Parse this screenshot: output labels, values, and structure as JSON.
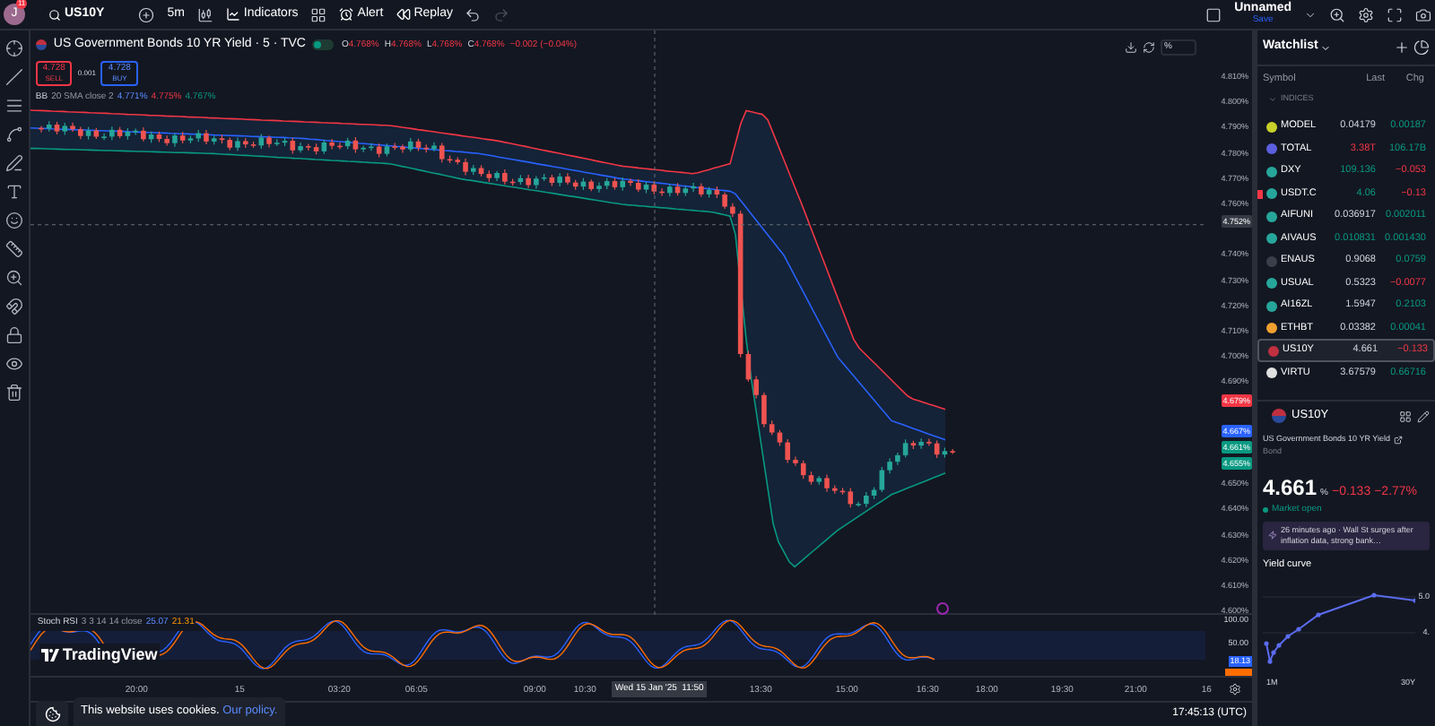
{
  "top_bar": {
    "avatar": "J",
    "notifications": "11",
    "symbol": "US10Y",
    "interval": "5m",
    "indicators": "Indicators",
    "alert": "Alert",
    "replay": "Replay",
    "layout_name": "Unnamed",
    "save": "Save"
  },
  "chart": {
    "title": "US Government Bonds 10 YR Yield · 5 · TVC",
    "market_open": true,
    "ohlc": [
      {
        "key": "O",
        "value": "4.768%"
      },
      {
        "key": "H",
        "value": "4.768%"
      },
      {
        "key": "L",
        "value": "4.768%"
      },
      {
        "key": "C",
        "value": "4.768%"
      }
    ],
    "change": "−0.002 (−0.04%)",
    "sell": {
      "price": "4.728",
      "label": "SELL"
    },
    "spread": "0.001",
    "buy": {
      "price": "4.728",
      "label": "BUY"
    },
    "indicator": {
      "name": "BB",
      "params": "20 SMA close 2",
      "values": [
        "4.771%",
        "4.775%",
        "4.767%"
      ]
    },
    "scale_mode": "%",
    "price_ticks": [
      "4.810%",
      "4.800%",
      "4.790%",
      "4.780%",
      "4.770%",
      "4.760%",
      "4.740%",
      "4.730%",
      "4.720%",
      "4.710%",
      "4.700%",
      "4.690%",
      "4.650%",
      "4.640%",
      "4.630%",
      "4.620%",
      "4.610%",
      "4.600%"
    ],
    "price_markers": [
      {
        "label": "4.752%",
        "kind": "crosshair"
      },
      {
        "label": "4.679%",
        "kind": "upper"
      },
      {
        "label": "4.667%",
        "kind": "middle"
      },
      {
        "label": "4.661%",
        "kind": "price"
      },
      {
        "label": "4.655%",
        "kind": "lower"
      }
    ],
    "logo": "TradingView",
    "stoch": {
      "name": "Stoch RSI",
      "params": "3 3 14 14 close",
      "values": [
        "25.07",
        "21.31"
      ],
      "ticks": [
        "100.00",
        "50.00"
      ],
      "marker": "18.13"
    },
    "time_ticks": [
      "20:00",
      "15",
      "03:20",
      "06:05",
      "09:00",
      "10:30",
      "13:30",
      "15:00",
      "16:30",
      "18:00",
      "19:30",
      "21:00",
      "16"
    ],
    "crosshair_time": "Wed 15 Jan '25",
    "crosshair_clock": "11:50",
    "clock": "17:45:13 (UTC)"
  },
  "watchlist": {
    "title": "Watchlist",
    "columns": [
      "Symbol",
      "Last",
      "Chg"
    ],
    "section": "INDICES",
    "rows": [
      {
        "symbol": "MODEL",
        "last": "0.04179",
        "chg": "0.00187",
        "last_rising": false,
        "last_falling": false,
        "rising": true,
        "color": "#c8d02a",
        "flagged": false,
        "selected": false
      },
      {
        "symbol": "TOTAL",
        "last": "3.38T",
        "chg": "106.17B",
        "last_rising": false,
        "last_falling": true,
        "rising": true,
        "color": "#5b5fe0",
        "flagged": false,
        "selected": false
      },
      {
        "symbol": "DXY",
        "last": "109.136",
        "chg": "−0.053",
        "last_rising": true,
        "last_falling": false,
        "rising": false,
        "color": "#26a69a",
        "flagged": false,
        "selected": false
      },
      {
        "symbol": "USDT.C",
        "last": "4.06",
        "chg": "−0.13",
        "last_rising": true,
        "last_falling": false,
        "rising": false,
        "color": "#26a69a",
        "flagged": true,
        "selected": false
      },
      {
        "symbol": "AIFUNI",
        "last": "0.036917",
        "chg": "0.002011",
        "last_rising": false,
        "last_falling": false,
        "rising": true,
        "color": "#26a69a",
        "flagged": false,
        "selected": false
      },
      {
        "symbol": "AIVAUS",
        "last": "0.010831",
        "chg": "0.001430",
        "last_rising": true,
        "last_falling": false,
        "rising": true,
        "color": "#26a69a",
        "flagged": false,
        "selected": false
      },
      {
        "symbol": "ENAUS",
        "last": "0.9068",
        "chg": "0.0759",
        "last_rising": false,
        "last_falling": false,
        "rising": true,
        "color": "#3a3f4b",
        "flagged": false,
        "selected": false
      },
      {
        "symbol": "USUAL",
        "last": "0.5323",
        "chg": "−0.0077",
        "last_rising": false,
        "last_falling": false,
        "rising": false,
        "color": "#26a69a",
        "flagged": false,
        "selected": false
      },
      {
        "symbol": "AI16ZL",
        "last": "1.5947",
        "chg": "0.2103",
        "last_rising": false,
        "last_falling": false,
        "rising": true,
        "color": "#26a69a",
        "flagged": false,
        "selected": false
      },
      {
        "symbol": "ETHBT",
        "last": "0.03382",
        "chg": "0.00041",
        "last_rising": false,
        "last_falling": false,
        "rising": true,
        "color": "#f0a030",
        "flagged": false,
        "selected": false
      },
      {
        "symbol": "US10Y",
        "last": "4.661",
        "chg": "−0.133",
        "last_rising": false,
        "last_falling": false,
        "rising": false,
        "color": "#c03040",
        "flagged": false,
        "selected": true
      },
      {
        "symbol": "VIRTU",
        "last": "3.67579",
        "chg": "0.66716",
        "last_rising": false,
        "last_falling": false,
        "rising": true,
        "color": "#e0e0e0",
        "flagged": false,
        "selected": false
      }
    ]
  },
  "details": {
    "symbol": "US10Y",
    "name": "US Government Bonds 10 YR Yield",
    "type": "Bond",
    "price": "4.661",
    "unit": "%",
    "change": "−0.133",
    "change_percent": "−2.77%",
    "rising": false,
    "status": "Market open",
    "news": "26 minutes ago · Wall St surges after inflation data, strong bank…",
    "yield_curve": {
      "title": "Yield curve",
      "ticks": [
        "5.0",
        "4."
      ],
      "labels": [
        "1M",
        "30Y"
      ]
    }
  },
  "cookie_banner": {
    "text": "This website uses cookies.",
    "link": "Our policy."
  }
}
